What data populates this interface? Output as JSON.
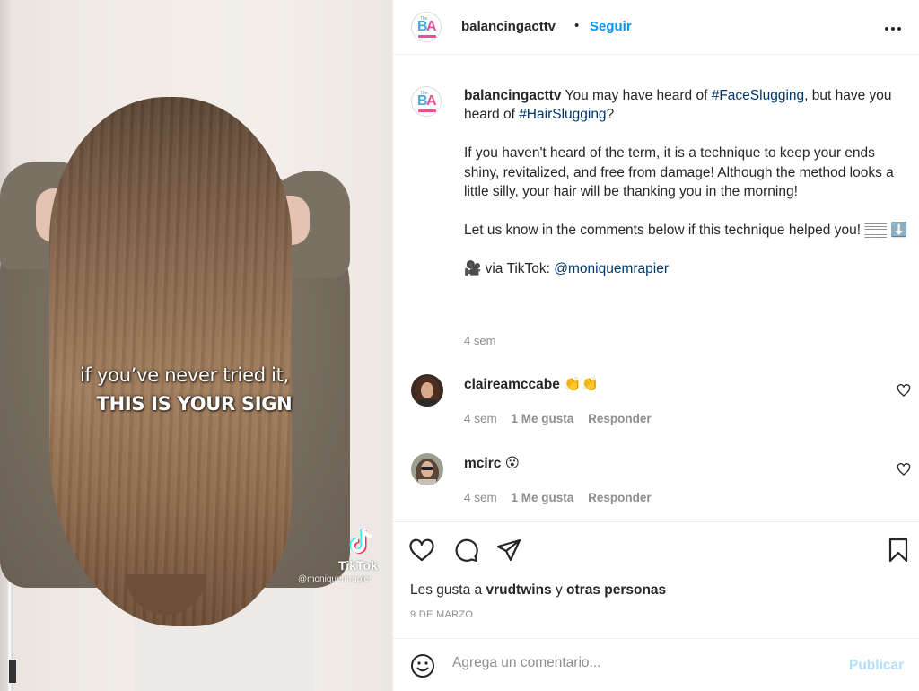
{
  "media": {
    "caption_line1": "if you’ve never tried it,",
    "caption_line2": "THIS IS YOUR SIGN",
    "watermark_brand": "TikTok",
    "watermark_user": "@moniquemrapier"
  },
  "header": {
    "username": "balancingacttv",
    "separator": "•",
    "follow_label": "Seguir",
    "avatar_text": "BA"
  },
  "post_caption": {
    "username": "balancingacttv",
    "text_1": " You may have heard of ",
    "hashtag_1": "#FaceSlugging",
    "text_2": ", but have you heard of ",
    "hashtag_2": "#HairSlugging",
    "text_3": "?",
    "paragraph_2": "If you haven't heard of the term, it is a technique to keep your ends shiny, revitalized, and free from damage! Although the method looks a little silly, your hair will be thanking you in the morning!",
    "paragraph_3": "Let us know in the comments below if this technique helped you! 𝄛𝄛 ⬇️",
    "via_prefix": "🎥 via TikTok: ",
    "via_mention": "@moniquemrapier",
    "time": "4 sem"
  },
  "comments": [
    {
      "username": "claireamccabe",
      "emoji": " 👏👏",
      "time": "4 sem",
      "likes": "1 Me gusta",
      "reply": "Responder"
    },
    {
      "username": "mcirc",
      "emoji": " 😮",
      "time": "4 sem",
      "likes": "1 Me gusta",
      "reply": "Responder"
    }
  ],
  "likes": {
    "prefix": "Les gusta a ",
    "user": "vrudtwins",
    "middle": " y ",
    "others": "otras personas"
  },
  "date": "9 DE MARZO",
  "add_comment": {
    "placeholder": "Agrega un comentario...",
    "publish_label": "Publicar"
  },
  "icons": [
    "heart-icon",
    "comment-icon",
    "share-icon",
    "bookmark-icon",
    "more-icon",
    "smile-icon",
    "tiktok-icon"
  ],
  "colors": {
    "accent": "#0095f6",
    "hashtag": "#00376b",
    "muted": "#8e8e8e",
    "publish_disabled": "#b2dffc",
    "text": "#262626"
  }
}
